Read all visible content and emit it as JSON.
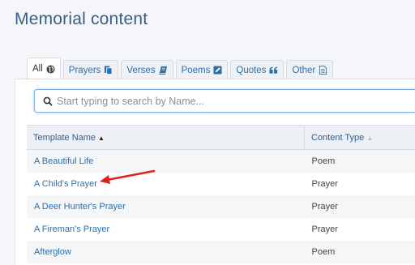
{
  "page": {
    "title": "Memorial content"
  },
  "tabs": [
    {
      "label": "All",
      "icon": "globe-icon"
    },
    {
      "label": "Prayers",
      "icon": "pages-icon"
    },
    {
      "label": "Verses",
      "icon": "book-icon"
    },
    {
      "label": "Poems",
      "icon": "edit-icon"
    },
    {
      "label": "Quotes",
      "icon": "quote-icon"
    },
    {
      "label": "Other",
      "icon": "document-icon"
    }
  ],
  "search": {
    "placeholder": "Start typing to search by Name...",
    "value": ""
  },
  "table": {
    "headers": {
      "name": "Template Name",
      "type": "Content Type"
    },
    "rows": [
      {
        "name": "A Beautiful Life",
        "type": "Poem"
      },
      {
        "name": "A Child's Prayer",
        "type": "Prayer"
      },
      {
        "name": "A Deer Hunter's Prayer",
        "type": "Prayer"
      },
      {
        "name": "A Fireman's Prayer",
        "type": "Prayer"
      },
      {
        "name": "Afterglow",
        "type": "Poem"
      }
    ]
  },
  "annotation": {
    "color": "#e0221f"
  },
  "colors": {
    "accent": "#2f6ea6",
    "title": "#3a5e86"
  }
}
